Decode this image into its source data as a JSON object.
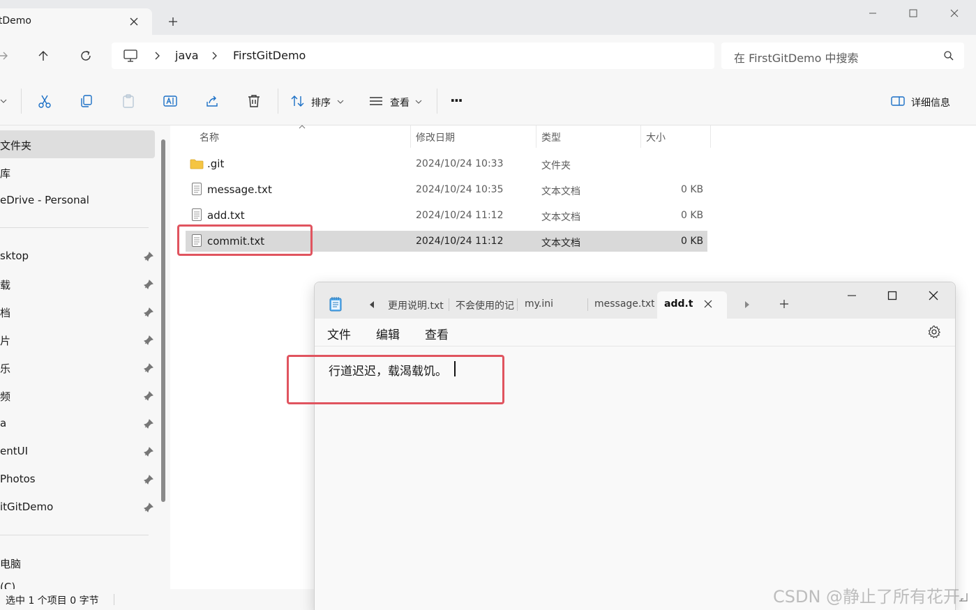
{
  "window": {
    "tab_title": "itDemo",
    "new_tab": "+"
  },
  "breadcrumb": [
    "java",
    "FirstGitDemo"
  ],
  "search": {
    "placeholder": "在 FirstGitDemo 中搜索"
  },
  "toolbar": {
    "sort_label": "排序",
    "view_label": "查看",
    "more_label": "···",
    "details_label": "详细信息"
  },
  "sidebar": {
    "top_items": [
      {
        "label": "文件夹",
        "selected": true
      },
      {
        "label": "库"
      },
      {
        "label": "eDrive - Personal"
      }
    ],
    "pinned_items": [
      "sktop",
      "载",
      "档",
      "片",
      "乐",
      "频",
      "a",
      "entUI",
      "Photos",
      "itGitDemo"
    ],
    "bottom_items": [
      "电脑",
      "(C)"
    ]
  },
  "columns": {
    "name": "名称",
    "modified": "修改日期",
    "type": "类型",
    "size": "大小"
  },
  "files": [
    {
      "name": ".git",
      "modified": "2024/10/24 10:33",
      "type": "文件夹",
      "size": "",
      "icon": "folder-icon"
    },
    {
      "name": "message.txt",
      "modified": "2024/10/24 10:35",
      "type": "文本文档",
      "size": "0 KB",
      "icon": "text-file-icon"
    },
    {
      "name": "add.txt",
      "modified": "2024/10/24 11:12",
      "type": "文本文档",
      "size": "0 KB",
      "icon": "text-file-icon"
    },
    {
      "name": "commit.txt",
      "modified": "2024/10/24 11:12",
      "type": "文本文档",
      "size": "0 KB",
      "icon": "text-file-icon",
      "selected": true
    }
  ],
  "status": "选中 1 个项目  0 字节",
  "notepad": {
    "tabs": [
      "更用说明.txt",
      "不会使用的记",
      "my.ini",
      "message.txt"
    ],
    "active_tab": "add.t:",
    "menu": {
      "file": "文件",
      "edit": "编辑",
      "view": "查看"
    },
    "content": "行道迟迟，载渴载饥。"
  },
  "watermark": "CSDN @静止了所有花开",
  "colors": {
    "highlight_red": "#e0545f",
    "selected_bg": "#d9d9d9",
    "accent_blue": "#1a6fc6"
  }
}
